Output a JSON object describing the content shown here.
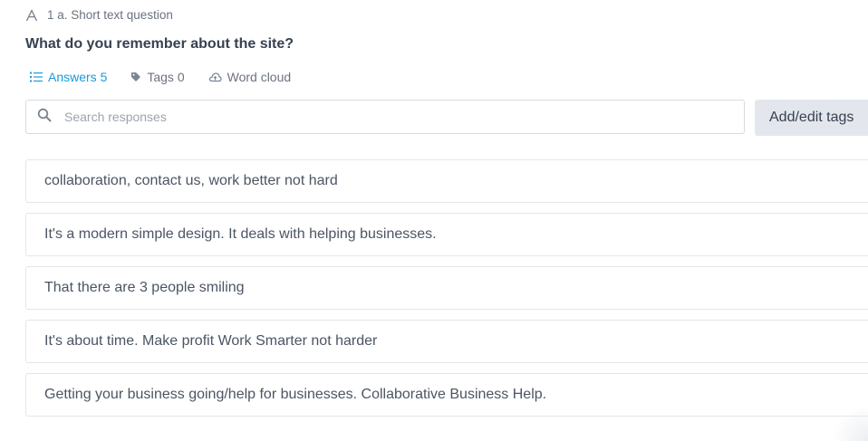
{
  "question": {
    "type_icon": "short-text-icon",
    "type_label": "1 a. Short text question",
    "title": "What do you remember about the site?"
  },
  "tabs": [
    {
      "icon": "list-icon",
      "label": "Answers 5",
      "active": true
    },
    {
      "icon": "tag-icon",
      "label": "Tags 0",
      "active": false
    },
    {
      "icon": "cloud-icon",
      "label": "Word cloud",
      "active": false
    }
  ],
  "search": {
    "icon": "search-icon",
    "placeholder": "Search responses",
    "value": ""
  },
  "add_edit_tags_label": "Add/edit tags",
  "answers": [
    "collaboration, contact us, work better not hard",
    "It's a modern simple design. It deals with helping businesses.",
    "That there are 3 people smiling",
    "It's about time. Make profit Work Smarter not harder",
    "Getting your business going/help for businesses. Collaborative Business Help."
  ],
  "colors": {
    "accent": "#1a9bd8",
    "text": "#374151",
    "muted": "#6b7280",
    "border": "#e3e6ea",
    "button_bg": "#e3e7ed"
  }
}
